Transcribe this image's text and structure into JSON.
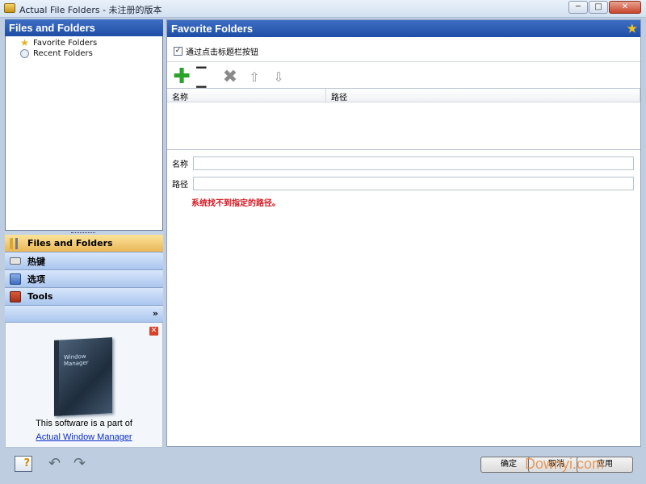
{
  "window": {
    "title": "Actual File Folders - 未注册的版本",
    "min": "─",
    "max": "□",
    "close": "✕"
  },
  "left": {
    "header": "Files and Folders",
    "tree": [
      {
        "label": "Favorite Folders",
        "icon": "star-icon"
      },
      {
        "label": "Recent Folders",
        "icon": "clock-icon"
      }
    ],
    "nav": [
      {
        "label": "Files and Folders",
        "icon": "folders-icon",
        "active": true
      },
      {
        "label": "热键",
        "icon": "keyboard-icon"
      },
      {
        "label": "选项",
        "icon": "options-icon"
      },
      {
        "label": "Tools",
        "icon": "tools-icon"
      }
    ],
    "more": "»",
    "ad": {
      "close": "✕",
      "box_title": "Window Manager",
      "text": "This software is a part of",
      "link": "Actual Window Manager"
    }
  },
  "right": {
    "header": "Favorite Folders",
    "checkbox": {
      "label": "通过点击标题栏按钮",
      "checked": true
    },
    "toolbar": {
      "add": "✚",
      "remove": "−−",
      "delete": "✖",
      "up": "⇧",
      "down": "⇩"
    },
    "columns": [
      "名称",
      "路径"
    ],
    "fields": {
      "name_label": "名称",
      "path_label": "路径"
    },
    "error": "系统找不到指定的路径。"
  },
  "footer": {
    "help": "?",
    "undo": "↶",
    "redo": "↷",
    "ok": "确定",
    "cancel": "取消",
    "apply": "应用",
    "watermark": "Downyi.com"
  }
}
